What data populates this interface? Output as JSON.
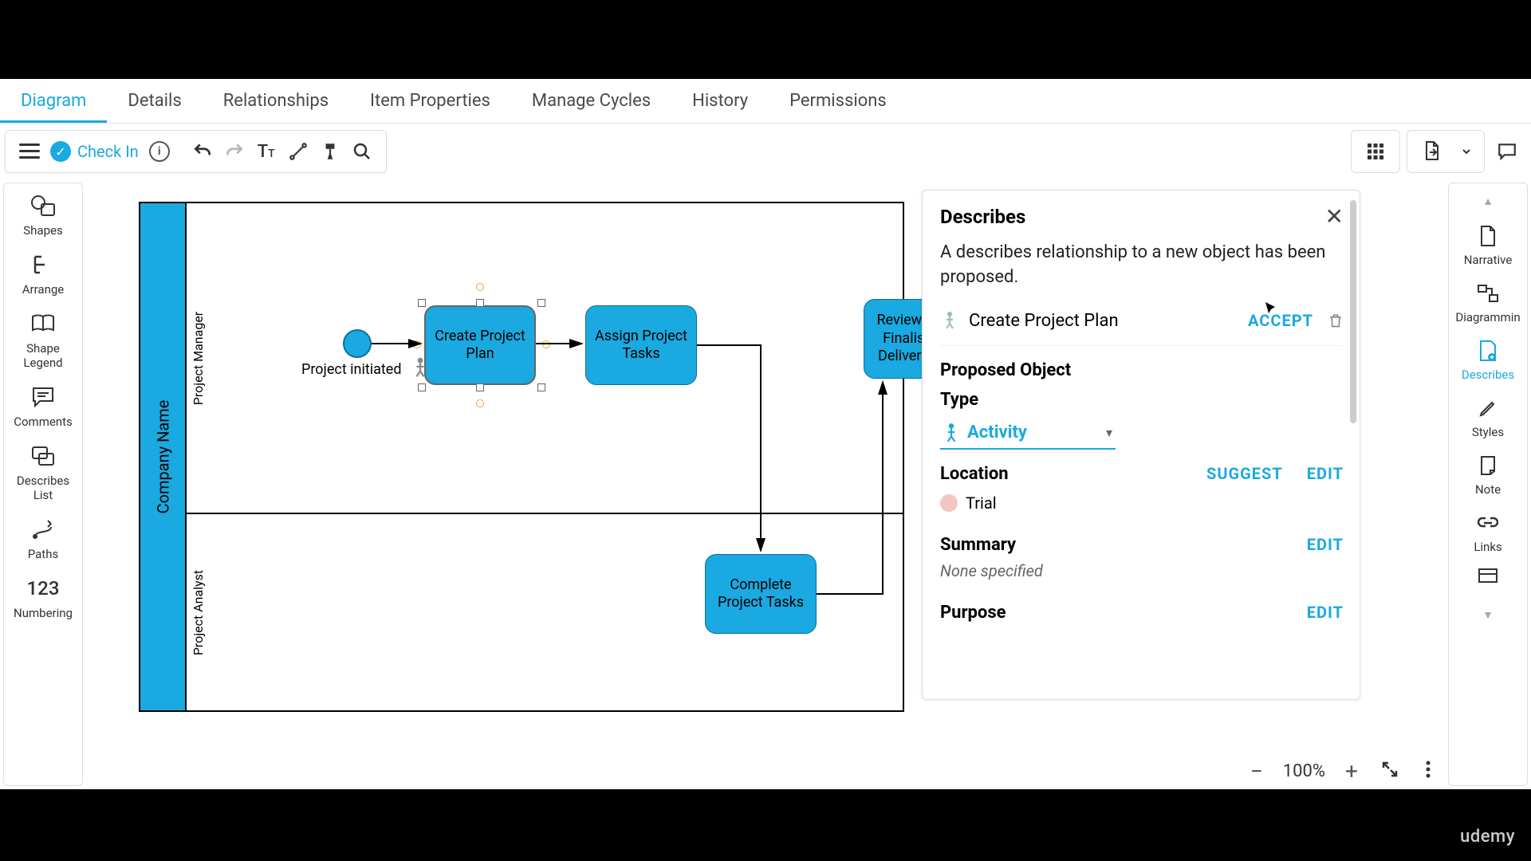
{
  "tabs": {
    "diagram": "Diagram",
    "details": "Details",
    "relationships": "Relationships",
    "item_properties": "Item Properties",
    "manage_cycles": "Manage Cycles",
    "history": "History",
    "permissions": "Permissions"
  },
  "toolbar": {
    "checkin_label": "Check In"
  },
  "left_palette": {
    "shapes": "Shapes",
    "arrange": "Arrange",
    "shape_legend_1": "Shape",
    "shape_legend_2": "Legend",
    "comments": "Comments",
    "describes_list_1": "Describes",
    "describes_list_2": "List",
    "paths": "Paths",
    "numbering": "Numbering"
  },
  "diagram": {
    "pool_label": "Company Name",
    "lane1_label": "Project Manager",
    "lane2_label": "Project Analyst",
    "project_initiated": "Project initiated",
    "task_create": "Create Project Plan",
    "task_assign": "Assign Project Tasks",
    "task_complete": "Complete Project Tasks",
    "task_review_1": "Review ar",
    "task_review_2": "Finalise",
    "task_review_3": "Deliverab"
  },
  "panel": {
    "title": "Describes",
    "description": "A describes relationship to a new object has been proposed.",
    "object_name": "Create Project Plan",
    "accept_label": "ACCEPT",
    "proposed_object": "Proposed Object",
    "type_label": "Type",
    "type_value": "Activity",
    "location_label": "Location",
    "location_value": "Trial",
    "suggest_label": "SUGGEST",
    "edit_label": "EDIT",
    "summary_label": "Summary",
    "none_specified": "None specified",
    "purpose_label": "Purpose"
  },
  "right_rail": {
    "narrative": "Narrative",
    "diagramming": "Diagrammin",
    "describes": "Describes",
    "styles": "Styles",
    "note": "Note",
    "links": "Links"
  },
  "bottom": {
    "zoom": "100%"
  },
  "watermark": "udemy"
}
